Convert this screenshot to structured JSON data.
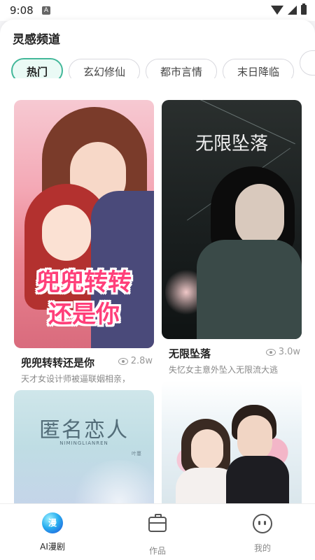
{
  "status_bar": {
    "time": "9:08",
    "notification_badge": "A"
  },
  "channel": {
    "title": "灵感频道"
  },
  "categories": [
    {
      "label": "热门",
      "active": true
    },
    {
      "label": "玄幻修仙",
      "active": false
    },
    {
      "label": "都市言情",
      "active": false
    },
    {
      "label": "末日降临",
      "active": false
    },
    {
      "label": "",
      "active": false
    }
  ],
  "cards": [
    {
      "cover_text": [
        "兜兜转转",
        "还是你"
      ],
      "title": "兜兜转转还是你",
      "views": "2.8w",
      "description": "天才女设计师被逼联姻相亲，"
    },
    {
      "cover_text": "无限坠落",
      "title": "无限坠落",
      "views": "3.0w",
      "description": "失忆女主意外坠入无限流大逃"
    },
    {
      "cover_text": "匿名恋人",
      "cover_subtext": "NIMINGLIANREN",
      "cover_author": "叶蔓"
    },
    {
      "cover_text": ""
    }
  ],
  "bottom_nav": {
    "items": [
      {
        "label": "AI漫剧",
        "icon": "ai-comic-icon",
        "icon_text": "漫",
        "active": true
      },
      {
        "label": "作品",
        "icon": "briefcase-icon",
        "active": false
      },
      {
        "label": "我的",
        "icon": "profile-face-icon",
        "active": false
      }
    ]
  },
  "colors": {
    "accent": "#43b89a",
    "chip_active_bg": "#eafaf5",
    "cover_title_pink": "#ff3f7a"
  }
}
